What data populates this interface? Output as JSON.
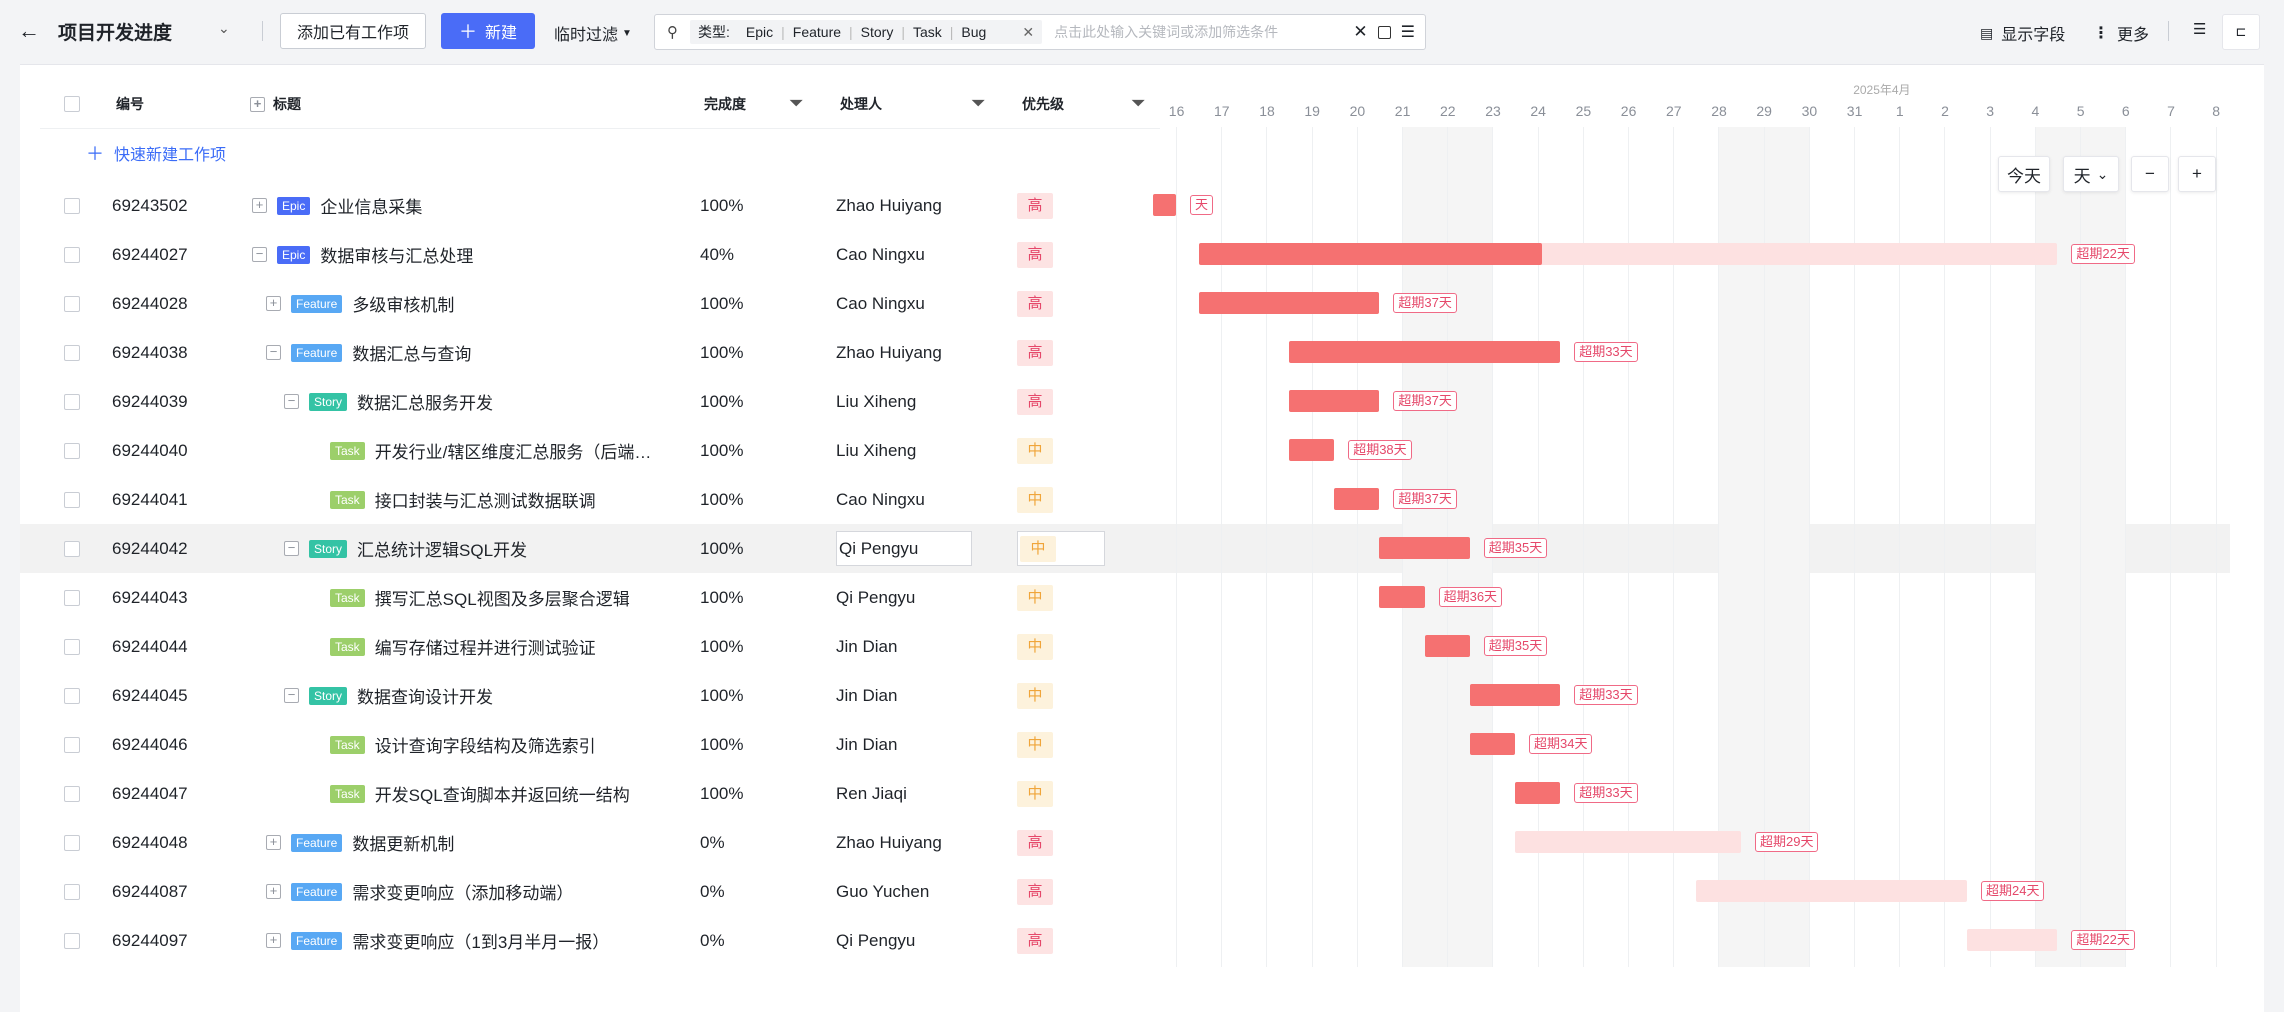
{
  "toolbar": {
    "title": "项目开发进度",
    "add_existing": "添加已有工作项",
    "new_label": "新建",
    "temp_filter": "临时过滤",
    "filter_label": "类型:",
    "filter_types": [
      "Epic",
      "Feature",
      "Story",
      "Task",
      "Bug"
    ],
    "filter_placeholder": "点击此处输入关键词或添加筛选条件",
    "show_fields": "显示字段",
    "more": "更多"
  },
  "table": {
    "headers": {
      "id": "编号",
      "title": "标题",
      "progress": "完成度",
      "assignee": "处理人",
      "priority": "优先级"
    },
    "quick_create": "快速新建工作项",
    "rows": [
      {
        "id": "69243502",
        "level": 0,
        "expand": "+",
        "type": "Epic",
        "title": "企业信息采集",
        "progress": "100%",
        "assignee": "Zhao Huiyang",
        "priority": "高"
      },
      {
        "id": "69244027",
        "level": 0,
        "expand": "−",
        "type": "Epic",
        "title": "数据审核与汇总处理",
        "progress": "40%",
        "assignee": "Cao Ningxu",
        "priority": "高"
      },
      {
        "id": "69244028",
        "level": 1,
        "expand": "+",
        "type": "Feature",
        "title": "多级审核机制",
        "progress": "100%",
        "assignee": "Cao Ningxu",
        "priority": "高"
      },
      {
        "id": "69244038",
        "level": 1,
        "expand": "−",
        "type": "Feature",
        "title": "数据汇总与查询",
        "progress": "100%",
        "assignee": "Zhao Huiyang",
        "priority": "高"
      },
      {
        "id": "69244039",
        "level": 2,
        "expand": "−",
        "type": "Story",
        "title": "数据汇总服务开发",
        "progress": "100%",
        "assignee": "Liu Xiheng",
        "priority": "高"
      },
      {
        "id": "69244040",
        "level": 3,
        "expand": "",
        "type": "Task",
        "title": "开发行业/辖区维度汇总服务（后端…",
        "progress": "100%",
        "assignee": "Liu Xiheng",
        "priority": "中"
      },
      {
        "id": "69244041",
        "level": 3,
        "expand": "",
        "type": "Task",
        "title": "接口封装与汇总测试数据联调",
        "progress": "100%",
        "assignee": "Cao Ningxu",
        "priority": "中"
      },
      {
        "id": "69244042",
        "level": 2,
        "expand": "−",
        "type": "Story",
        "title": "汇总统计逻辑SQL开发",
        "progress": "100%",
        "assignee": "Qi Pengyu",
        "priority": "中"
      },
      {
        "id": "69244043",
        "level": 3,
        "expand": "",
        "type": "Task",
        "title": "撰写汇总SQL视图及多层聚合逻辑",
        "progress": "100%",
        "assignee": "Qi Pengyu",
        "priority": "中"
      },
      {
        "id": "69244044",
        "level": 3,
        "expand": "",
        "type": "Task",
        "title": "编写存储过程并进行测试验证",
        "progress": "100%",
        "assignee": "Jin Dian",
        "priority": "中"
      },
      {
        "id": "69244045",
        "level": 2,
        "expand": "−",
        "type": "Story",
        "title": "数据查询设计开发",
        "progress": "100%",
        "assignee": "Jin Dian",
        "priority": "中"
      },
      {
        "id": "69244046",
        "level": 3,
        "expand": "",
        "type": "Task",
        "title": "设计查询字段结构及筛选索引",
        "progress": "100%",
        "assignee": "Jin Dian",
        "priority": "中"
      },
      {
        "id": "69244047",
        "level": 3,
        "expand": "",
        "type": "Task",
        "title": "开发SQL查询脚本并返回统一结构",
        "progress": "100%",
        "assignee": "Ren Jiaqi",
        "priority": "中"
      },
      {
        "id": "69244048",
        "level": 1,
        "expand": "+",
        "type": "Feature",
        "title": "数据更新机制",
        "progress": "0%",
        "assignee": "Zhao Huiyang",
        "priority": "高"
      },
      {
        "id": "69244087",
        "level": 1,
        "expand": "+",
        "type": "Feature",
        "title": "需求变更响应（添加移动端）",
        "progress": "0%",
        "assignee": "Guo Yuchen",
        "priority": "高"
      },
      {
        "id": "69244097",
        "level": 1,
        "expand": "+",
        "type": "Feature",
        "title": "需求变更响应（1到3月半月一报）",
        "progress": "0%",
        "assignee": "Qi Pengyu",
        "priority": "高"
      }
    ]
  },
  "gantt": {
    "month_label": "2025年4月",
    "days": [
      "16",
      "17",
      "18",
      "19",
      "20",
      "21",
      "22",
      "23",
      "24",
      "25",
      "26",
      "27",
      "28",
      "29",
      "30",
      "31",
      "1",
      "2",
      "3",
      "4",
      "5",
      "6",
      "7",
      "8"
    ],
    "today_button": "今天",
    "scale_label": "天",
    "bars": [
      {
        "start": -0.5,
        "end": 0,
        "progress": 1,
        "overdue": "天"
      },
      {
        "start": 0.5,
        "end": 19.5,
        "progress": 0.4,
        "overdue": "超期22天"
      },
      {
        "start": 0.5,
        "end": 4.5,
        "progress": 1,
        "overdue": "超期37天"
      },
      {
        "start": 2.5,
        "end": 8.5,
        "progress": 1,
        "overdue": "超期33天"
      },
      {
        "start": 2.5,
        "end": 4.5,
        "progress": 1,
        "overdue": "超期37天"
      },
      {
        "start": 2.5,
        "end": 3.5,
        "progress": 1,
        "overdue": "超期38天"
      },
      {
        "start": 3.5,
        "end": 4.5,
        "progress": 1,
        "overdue": "超期37天"
      },
      {
        "start": 4.5,
        "end": 6.5,
        "progress": 1,
        "overdue": "超期35天"
      },
      {
        "start": 4.5,
        "end": 5.5,
        "progress": 1,
        "overdue": "超期36天"
      },
      {
        "start": 5.5,
        "end": 6.5,
        "progress": 1,
        "overdue": "超期35天"
      },
      {
        "start": 6.5,
        "end": 8.5,
        "progress": 1,
        "overdue": "超期33天"
      },
      {
        "start": 6.5,
        "end": 7.5,
        "progress": 1,
        "overdue": "超期34天"
      },
      {
        "start": 7.5,
        "end": 8.5,
        "progress": 1,
        "overdue": "超期33天"
      },
      {
        "start": 7.5,
        "end": 12.5,
        "progress": 0,
        "overdue": "超期29天"
      },
      {
        "start": 11.5,
        "end": 17.5,
        "progress": 0,
        "overdue": "超期24天"
      },
      {
        "start": 17.5,
        "end": 19.5,
        "progress": 0,
        "overdue": "超期22天"
      }
    ]
  },
  "colors": {
    "Epic": "#4a6cf7",
    "Feature": "#58a8f4",
    "Story": "#34c3a5",
    "Task": "#9ccf6a",
    "bar_done": "#f57171",
    "bar_todo": "#fde1e1",
    "prio_high_bg": "#fde3e3",
    "prio_high_fg": "#e5486a",
    "prio_mid_bg": "#fdf2dc",
    "prio_mid_fg": "#f0a53a"
  }
}
